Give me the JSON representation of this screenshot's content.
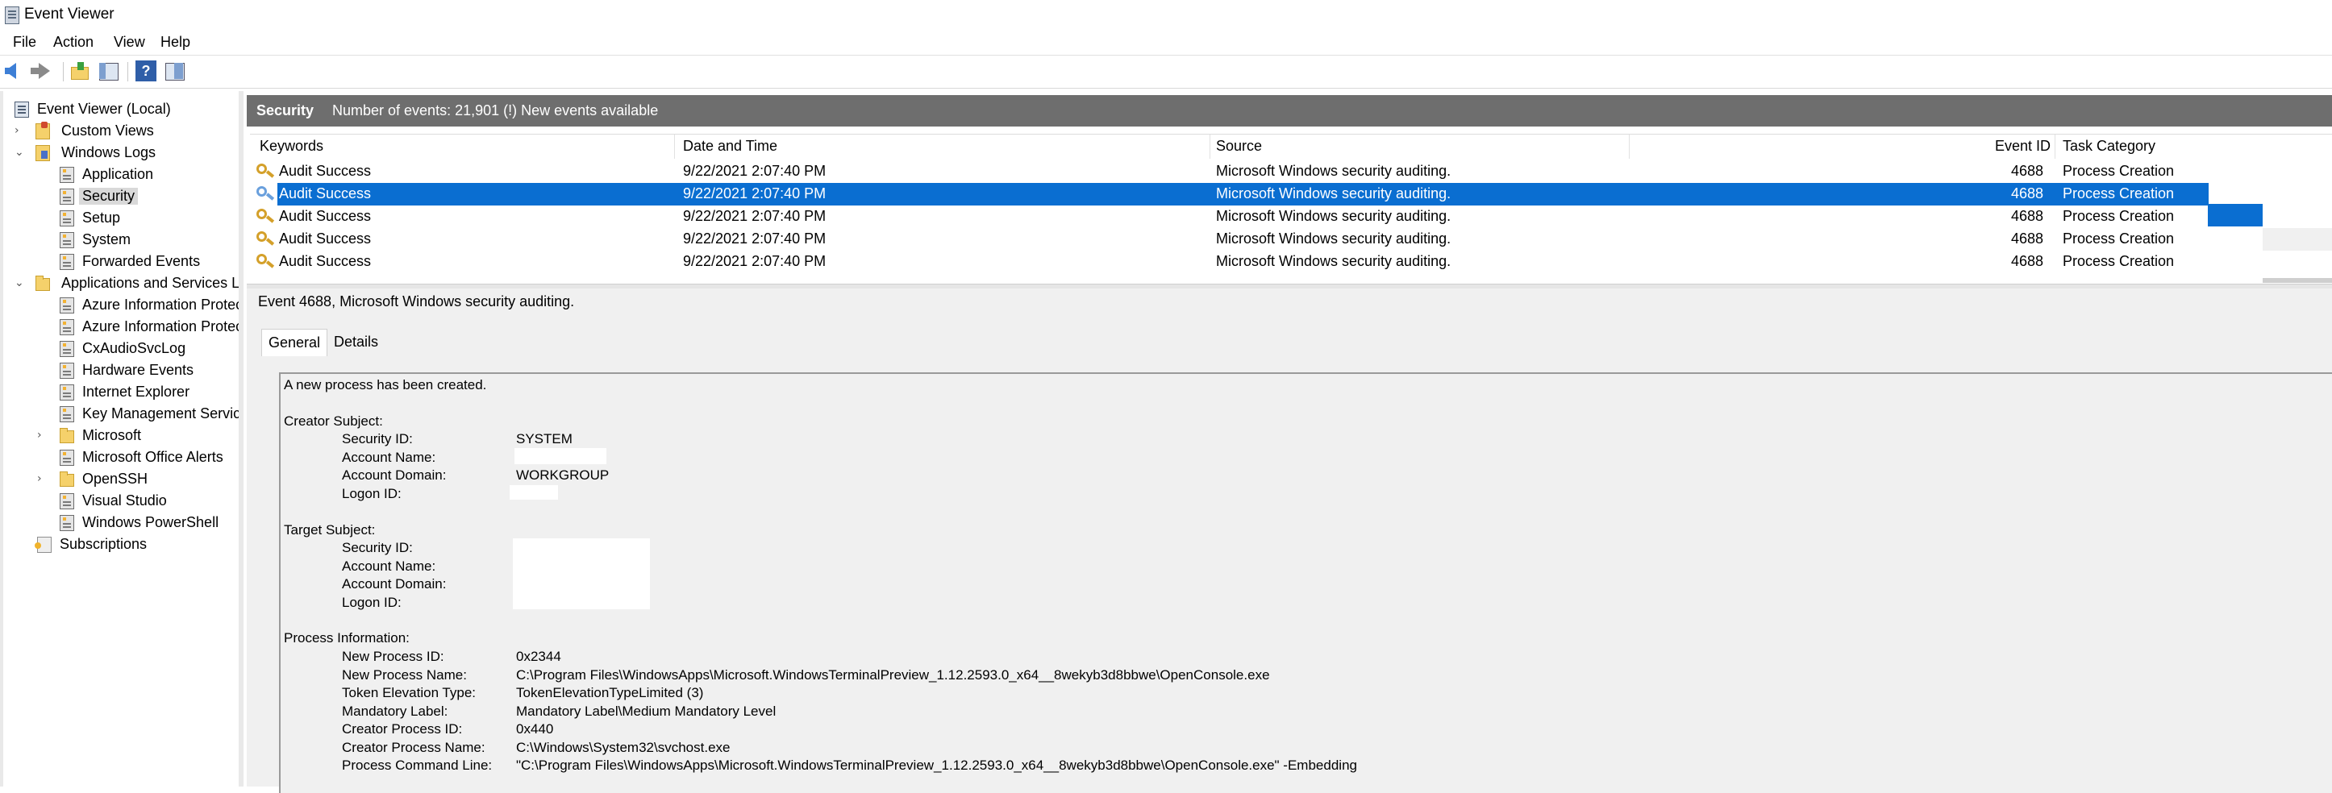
{
  "window": {
    "title": "Event Viewer"
  },
  "menu": [
    "File",
    "Action",
    "View",
    "Help"
  ],
  "toolbar": [
    "back-icon",
    "forward-icon",
    "up-folder-icon",
    "show-hide-tree-icon",
    "help-icon",
    "action-pane-icon"
  ],
  "tree": {
    "root": "Event Viewer (Local)",
    "custom_views": "Custom Views",
    "windows_logs": "Windows Logs",
    "windows_logs_items": [
      "Application",
      "Security",
      "Setup",
      "System",
      "Forwarded Events"
    ],
    "apps_services": "Applications and Services Log",
    "apps_services_items": [
      "Azure Information Protect",
      "Azure Information Protect",
      "CxAudioSvcLog",
      "Hardware Events",
      "Internet Explorer",
      "Key Management Service",
      "Microsoft",
      "Microsoft Office Alerts",
      "OpenSSH",
      "Visual Studio",
      "Windows PowerShell"
    ],
    "subscriptions": "Subscriptions",
    "selected": "Security"
  },
  "header": {
    "log_name": "Security",
    "summary": "Number of events: 21,901 (!) New events available"
  },
  "grid": {
    "columns": [
      "Keywords",
      "Date and Time",
      "Source",
      "Event ID",
      "Task Category"
    ],
    "rows": [
      [
        "Audit Success",
        "9/22/2021 2:07:40 PM",
        "Microsoft Windows security auditing.",
        "4688",
        "Process Creation"
      ],
      [
        "Audit Success",
        "9/22/2021 2:07:40 PM",
        "Microsoft Windows security auditing.",
        "4688",
        "Process Creation"
      ],
      [
        "Audit Success",
        "9/22/2021 2:07:40 PM",
        "Microsoft Windows security auditing.",
        "4688",
        "Process Creation"
      ],
      [
        "Audit Success",
        "9/22/2021 2:07:40 PM",
        "Microsoft Windows security auditing.",
        "4688",
        "Process Creation"
      ],
      [
        "Audit Success",
        "9/22/2021 2:07:40 PM",
        "Microsoft Windows security auditing.",
        "4688",
        "Process Creation"
      ]
    ],
    "selected_row": 1,
    "selection_color": "#0a6ed1"
  },
  "detail": {
    "title": "Event 4688, Microsoft Windows security auditing.",
    "tabs": [
      "General",
      "Details"
    ],
    "active_tab": "General",
    "intro": "A new process has been created.",
    "creator_heading": "Creator Subject:",
    "creator_labels": [
      "Security ID:",
      "Account Name:",
      "Account Domain:",
      "Logon ID:"
    ],
    "creator_values": [
      "SYSTEM",
      "",
      "WORKGROUP",
      ""
    ],
    "target_heading": "Target Subject:",
    "target_labels": [
      "Security ID:",
      "Account Name:",
      "Account Domain:",
      "Logon ID:"
    ],
    "process_heading": "Process Information:",
    "process_labels": [
      "New Process ID:",
      "New Process Name:",
      "Token Elevation Type:",
      "Mandatory Label:",
      "Creator Process ID:",
      "Creator Process Name:",
      "Process Command Line:"
    ],
    "process_values": [
      "0x2344",
      "C:\\Program Files\\WindowsApps\\Microsoft.WindowsTerminalPreview_1.12.2593.0_x64__8wekyb3d8bbwe\\OpenConsole.exe",
      "TokenElevationTypeLimited (3)",
      "Mandatory Label\\Medium Mandatory Level",
      "0x440",
      "C:\\Windows\\System32\\svchost.exe",
      "\"C:\\Program Files\\WindowsApps\\Microsoft.WindowsTerminalPreview_1.12.2593.0_x64__8wekyb3d8bbwe\\OpenConsole.exe\" -Embedding"
    ]
  }
}
